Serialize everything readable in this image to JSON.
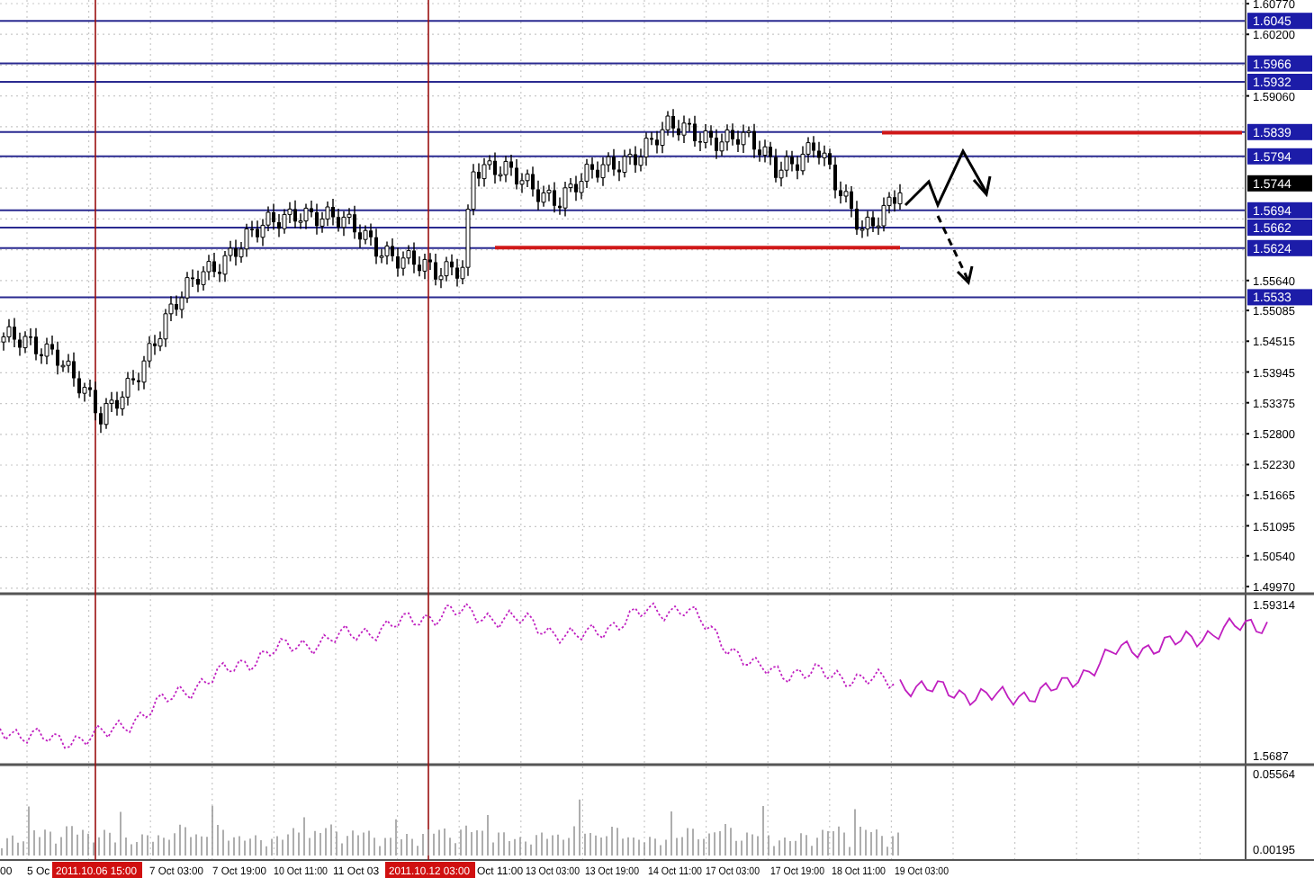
{
  "price_axis": [
    {
      "label": "1.60770",
      "kind": "tick"
    },
    {
      "label": "1.6045",
      "kind": "level"
    },
    {
      "label": "1.60200",
      "kind": "tick"
    },
    {
      "label": "1.5966",
      "kind": "level"
    },
    {
      "label": "1.5932",
      "kind": "level"
    },
    {
      "label": "1.59060",
      "kind": "tick"
    },
    {
      "label": "1.5839",
      "kind": "level"
    },
    {
      "label": "1.5794",
      "kind": "level"
    },
    {
      "label": "1.5744",
      "kind": "current"
    },
    {
      "label": "1.5694",
      "kind": "level"
    },
    {
      "label": "1.5662",
      "kind": "level"
    },
    {
      "label": "1.5624",
      "kind": "level"
    },
    {
      "label": "1.55640",
      "kind": "tick"
    },
    {
      "label": "1.5533",
      "kind": "level"
    },
    {
      "label": "1.55085",
      "kind": "tick"
    },
    {
      "label": "1.54515",
      "kind": "tick"
    },
    {
      "label": "1.53945",
      "kind": "tick"
    },
    {
      "label": "1.53375",
      "kind": "tick"
    },
    {
      "label": "1.52800",
      "kind": "tick"
    },
    {
      "label": "1.52230",
      "kind": "tick"
    },
    {
      "label": "1.51665",
      "kind": "tick"
    },
    {
      "label": "1.51095",
      "kind": "tick"
    },
    {
      "label": "1.50540",
      "kind": "tick"
    },
    {
      "label": "1.49970",
      "kind": "tick"
    }
  ],
  "indicator_axis": [
    "1.59314",
    "1.5687"
  ],
  "volume_axis": [
    "0.05564",
    "0.00195"
  ],
  "time_axis": [
    {
      "label": "00",
      "kind": "tick"
    },
    {
      "label": "5 Oc",
      "kind": "tick"
    },
    {
      "label": "2011.10.06 15:00",
      "kind": "cursor"
    },
    {
      "label": "7 Oct 03:00",
      "kind": "tick"
    },
    {
      "label": "7 Oct 19:00",
      "kind": "tick"
    },
    {
      "label": "10 Oct 11:00",
      "kind": "tick"
    },
    {
      "label": "11 Oct 03",
      "kind": "tick"
    },
    {
      "label": "2011.10.12 03:00",
      "kind": "cursor"
    },
    {
      "label": "Oct 11:00",
      "kind": "tick"
    },
    {
      "label": "13 Oct 03:00",
      "kind": "tick"
    },
    {
      "label": "13 Oct 19:00",
      "kind": "tick"
    },
    {
      "label": "14 Oct 11:00",
      "kind": "tick"
    },
    {
      "label": "17 Oct 03:00",
      "kind": "tick"
    },
    {
      "label": "17 Oct 19:00",
      "kind": "tick"
    },
    {
      "label": "18 Oct 11:00",
      "kind": "tick"
    },
    {
      "label": "19 Oct 03:00",
      "kind": "tick"
    }
  ]
}
